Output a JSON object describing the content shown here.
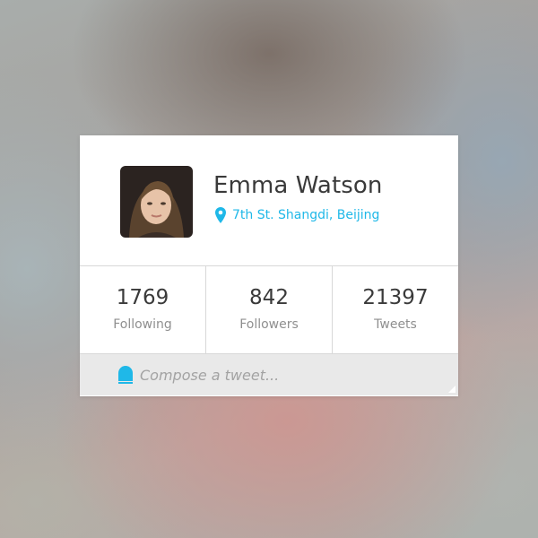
{
  "profile": {
    "name": "Emma Watson",
    "location": "7th St. Shangdi, Beijing",
    "avatar_icon": "user-avatar-photo",
    "location_icon": "map-pin-icon"
  },
  "stats": [
    {
      "value": "1769",
      "label": "Following"
    },
    {
      "value": "842",
      "label": "Followers"
    },
    {
      "value": "21397",
      "label": "Tweets"
    }
  ],
  "compose": {
    "placeholder": "Compose a tweet...",
    "icon": "compose-bubble-icon"
  },
  "colors": {
    "accent": "#1fb8e8",
    "text": "#3a3a3a",
    "muted": "#8f8f8f",
    "compose_bg": "#e9e9e9"
  }
}
